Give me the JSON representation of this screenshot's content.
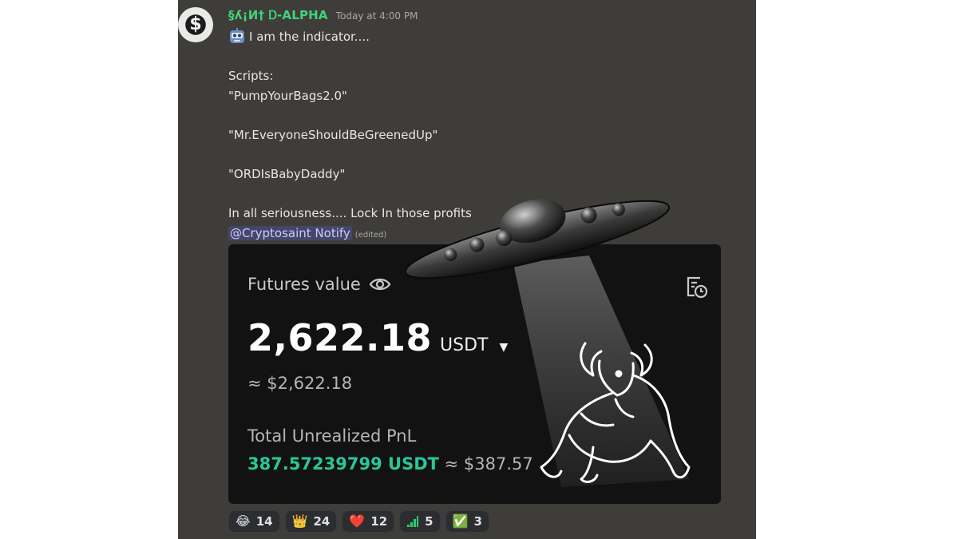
{
  "message": {
    "author": "§ʎ¡И† Ꭰ-ALPHA",
    "timestamp": "Today at 4:00 PM",
    "lines": [
      "I am the indicator....",
      "",
      "Scripts:",
      "\"PumpYourBags2.0\"",
      "",
      "\"Mr.EveryoneShouldBeGreenedUp\"",
      "",
      "\"ORDIsBabyDaddy\"",
      "",
      "In all seriousness.... Lock In those profits"
    ],
    "mention": "@Cryptosaint Notify",
    "edited_label": "(edited)"
  },
  "embed": {
    "title": "Futures value",
    "value": "2,622.18",
    "currency": "USDT",
    "approx": "≈ $2,622.18",
    "pnl_label": "Total Unrealized PnL",
    "pnl_value": "387.57239799 USDT",
    "pnl_approx": "≈ $387.57"
  },
  "reactions": [
    {
      "icon": "😂",
      "icon_name": "joy-icon",
      "count": "14"
    },
    {
      "icon": "👑",
      "icon_name": "crown-icon",
      "count": "24"
    },
    {
      "icon": "❤️",
      "icon_name": "heart-icon",
      "count": "12"
    },
    {
      "icon": "⬈",
      "icon_name": "green-chart-icon",
      "count": "5"
    },
    {
      "icon": "✅",
      "icon_name": "check-icon",
      "count": "3"
    }
  ],
  "colors": {
    "background": "#3f3d3a",
    "username": "#3fd57b",
    "pnl_green": "#29c79a",
    "embed": "#121212"
  }
}
